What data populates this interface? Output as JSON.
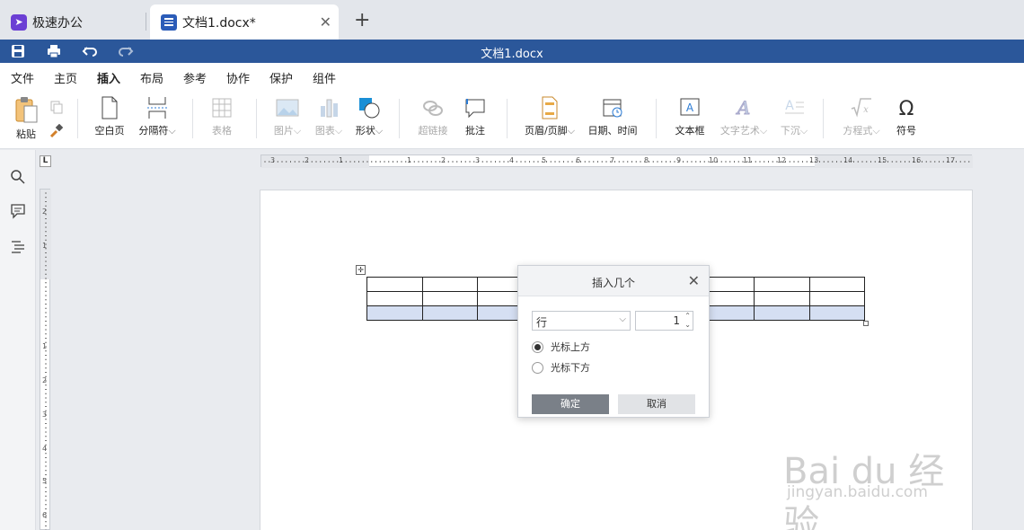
{
  "tabs": [
    {
      "label": "极速办公",
      "icon": "rocket-icon"
    },
    {
      "label": "文档1.docx*",
      "icon": "document-icon",
      "active": true
    }
  ],
  "window": {
    "title": "文档1.docx"
  },
  "menu": [
    "文件",
    "主页",
    "插入",
    "布局",
    "参考",
    "协作",
    "保护",
    "组件"
  ],
  "active_menu": "插入",
  "ribbon": {
    "paste": "粘贴",
    "blank_page": "空白页",
    "separator": "分隔符",
    "table": "表格",
    "picture": "图片",
    "chart": "图表",
    "shape": "形状",
    "hyperlink": "超链接",
    "comment": "批注",
    "header_footer": "页眉/页脚",
    "date_time": "日期、时间",
    "text_box": "文本框",
    "text_art": "文字艺术",
    "drop_cap": "下沉",
    "equation": "方程式",
    "symbol": "符号"
  },
  "ruler": {
    "corner": "L",
    "h_numbers": [
      "3",
      "2",
      "1",
      "1",
      "2",
      "3",
      "4",
      "5",
      "6",
      "7",
      "8",
      "9",
      "10",
      "11",
      "12",
      "13",
      "14",
      "15",
      "16",
      "17"
    ],
    "v_numbers": [
      "2",
      "1",
      "1",
      "2",
      "3",
      "4",
      "5",
      "6",
      "7"
    ]
  },
  "table": {
    "rows": 3,
    "cols": 9,
    "selected_row": 3
  },
  "dialog": {
    "title": "插入几个",
    "type_value": "行",
    "count_value": "1",
    "option_above": "光标上方",
    "option_below": "光标下方",
    "selected_option": "above",
    "ok_label": "确定",
    "cancel_label": "取消"
  },
  "watermark": {
    "brand": "Bai du 经验",
    "url": "jingyan.baidu.com"
  },
  "colors": {
    "titlebar": "#2b579a",
    "accent": "#2b579a",
    "selection": "#d5dff2"
  }
}
